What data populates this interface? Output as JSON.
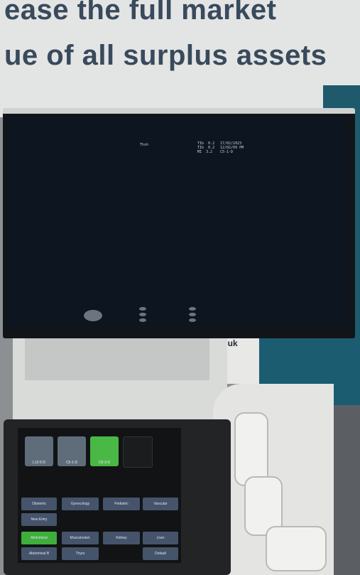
{
  "banner": {
    "line1": "ease the full market",
    "line2": "ue of all surplus assets"
  },
  "backdrop": {
    "url_fragment": "o.uk"
  },
  "monitor": {
    "header_center": "Thsh",
    "header_right_col1": "TIb  0.2\nTIb  0.2\nMI  3.2",
    "header_right_col2": "17/02/2023\n12/02/09 PM\nC5-1-D"
  },
  "touch": {
    "probes": [
      {
        "label": "L12-5-D"
      },
      {
        "label": "C5-1-D"
      },
      {
        "label": "C9-3-D"
      }
    ],
    "buttons": {
      "obstetric": "Obstetric",
      "gynecology": "Gynecology",
      "pediatric": "Pediatric",
      "vascular": "Vascular",
      "new_entry": "New Entry",
      "abdominal": "Abdominal",
      "musculoskel": "Musculoskel.",
      "kidney": "Kidney",
      "liver": "Liver",
      "abdominal_b": "Abdominal B",
      "thyro": "Thyro",
      "default": "Default"
    }
  }
}
